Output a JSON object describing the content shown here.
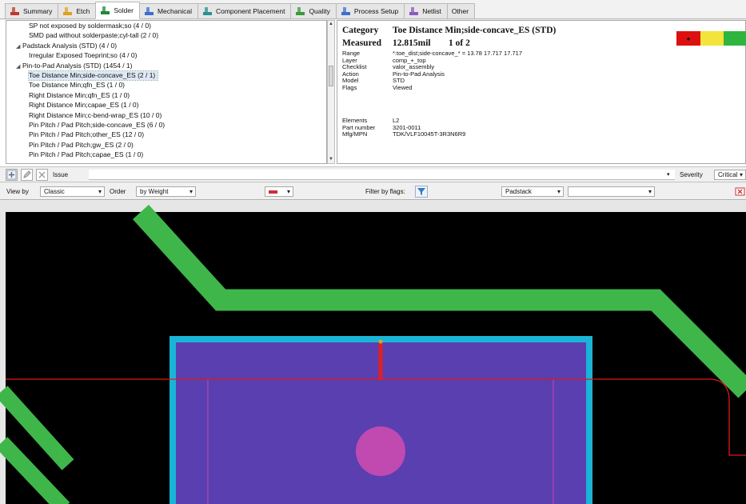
{
  "tabs": [
    {
      "label": "Summary",
      "icon": "summary-icon",
      "color": "#c0392b",
      "active": false
    },
    {
      "label": "Etch",
      "icon": "etch-icon",
      "color": "#e0a020",
      "active": false
    },
    {
      "label": "Solder",
      "icon": "solder-icon",
      "color": "#1e8a3a",
      "active": true
    },
    {
      "label": "Mechanical",
      "icon": "mechanical-icon",
      "color": "#3b6fd0",
      "active": false
    },
    {
      "label": "Component Placement",
      "icon": "component-placement-icon",
      "color": "#2a8f8f",
      "active": false
    },
    {
      "label": "Quality",
      "icon": "quality-icon",
      "color": "#3a9a3a",
      "active": false
    },
    {
      "label": "Process Setup",
      "icon": "process-setup-icon",
      "color": "#3b6fd0",
      "active": false
    },
    {
      "label": "Netlist",
      "icon": "netlist-icon",
      "color": "#8a5ac0",
      "active": false
    },
    {
      "label": "Other",
      "icon": "",
      "color": "",
      "active": false
    }
  ],
  "tree": {
    "items": [
      {
        "label": "SP not exposed by soldermask;so (4 / 0)",
        "level": 2,
        "selected": false,
        "expanded": null
      },
      {
        "label": "SMD pad without solderpaste;cyl-tall (2 / 0)",
        "level": 2,
        "selected": false,
        "expanded": null
      },
      {
        "label": "Padstack Analysis (STD) (4 / 0)",
        "level": 1,
        "selected": false,
        "expanded": true
      },
      {
        "label": "Irregular Exposed Toeprint;so (4 / 0)",
        "level": 2,
        "selected": false,
        "expanded": null
      },
      {
        "label": "Pin-to-Pad Analysis (STD) (1454 / 1)",
        "level": 1,
        "selected": false,
        "expanded": true
      },
      {
        "label": "Toe Distance Min;side-concave_ES (2 / 1)",
        "level": 2,
        "selected": true,
        "expanded": null
      },
      {
        "label": "Toe Distance Min;qfn_ES (1 / 0)",
        "level": 2,
        "selected": false,
        "expanded": null
      },
      {
        "label": "Right Distance Min;qfn_ES (1 / 0)",
        "level": 2,
        "selected": false,
        "expanded": null
      },
      {
        "label": "Right Distance Min;capae_ES (1 / 0)",
        "level": 2,
        "selected": false,
        "expanded": null
      },
      {
        "label": "Right Distance Min;c-bend-wrap_ES (10 / 0)",
        "level": 2,
        "selected": false,
        "expanded": null
      },
      {
        "label": "Pin Pitch / Pad Pitch;side-concave_ES (6 / 0)",
        "level": 2,
        "selected": false,
        "expanded": null
      },
      {
        "label": "Pin Pitch / Pad Pitch;other_ES (12 / 0)",
        "level": 2,
        "selected": false,
        "expanded": null
      },
      {
        "label": "Pin Pitch / Pad Pitch;gw_ES (2 / 0)",
        "level": 2,
        "selected": false,
        "expanded": null
      },
      {
        "label": "Pin Pitch / Pad Pitch;capae_ES (1 / 0)",
        "level": 2,
        "selected": false,
        "expanded": null
      }
    ]
  },
  "details": {
    "category_label": "Category",
    "category_value": "Toe Distance Min;side-concave_ES  (STD)",
    "measured_label": "Measured",
    "measured_value": "12.815mil",
    "measured_count": "1 of 2",
    "fields": [
      {
        "k": "Range",
        "v": "*:toe_dist;side-concave_* = 13.78 17.717 17.717"
      },
      {
        "k": "Layer",
        "v": "comp_+_top"
      },
      {
        "k": "Checklist",
        "v": "valor_assembly"
      },
      {
        "k": "Action",
        "v": "Pin-to-Pad Analysis"
      },
      {
        "k": "Model",
        "v": "STD"
      },
      {
        "k": "Flags",
        "v": "Viewed"
      }
    ],
    "fields2": [
      {
        "k": "Elements",
        "v": "L2"
      },
      {
        "k": "Part number",
        "v": "3201-0011"
      },
      {
        "k": "Mfg/MPN",
        "v": "TDK/VLF10045T-3R3N6R9"
      }
    ],
    "severity_colors": [
      "#dd1010",
      "#f2e43a",
      "#2fb53e"
    ],
    "severity_marker": "●"
  },
  "issue_bar": {
    "issue_label": "Issue",
    "severity_label": "Severity",
    "severity_value": "Critical"
  },
  "view_bar": {
    "view_by_label": "View by",
    "view_by_value": "Classic",
    "order_label": "Order",
    "order_value": "by Weight",
    "filter_label": "Filter by flags:",
    "padstack_value": "Padstack",
    "marker_color": "#d42a3a"
  },
  "canvas": {
    "colors": {
      "background": "#000000",
      "trace": "#3fb649",
      "pad_border": "#1ab4d6",
      "pad_fill": "#5a3fb0",
      "net_line": "#e01818",
      "drill": "#c04ab0",
      "measure": "#e02020"
    }
  }
}
